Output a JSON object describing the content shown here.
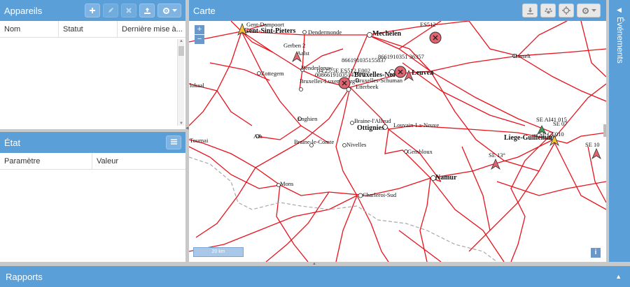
{
  "devices_panel": {
    "title": "Appareils",
    "columns": [
      "Nom",
      "Statut",
      "Dernière mise à..."
    ]
  },
  "state_panel": {
    "title": "État",
    "columns": [
      "Paramètre",
      "Valeur"
    ]
  },
  "map_panel": {
    "title": "Carte",
    "scale": "20 km",
    "zoom_in": "+",
    "zoom_out": "−",
    "info": "i",
    "cities": [
      {
        "name": "Gent-Dampoort"
      },
      {
        "name": "Gent-Sint-Pieters",
        "bold": true
      },
      {
        "name": "Dendermonde"
      },
      {
        "name": "Mechelen",
        "bold": true
      },
      {
        "name": "Gerben 2"
      },
      {
        "name": "Aalst"
      },
      {
        "name": "Denderleeuw"
      },
      {
        "name": "Zottegem"
      },
      {
        "name": "Bruxelles-Luxembourg"
      },
      {
        "name": "Bruxelles-Nord",
        "bold": true
      },
      {
        "name": "Leuven",
        "bold": true
      },
      {
        "name": "Bruxelles-Schuman"
      },
      {
        "name": "Etterbeek"
      },
      {
        "name": "Hasselt"
      },
      {
        "name": "Enghien"
      },
      {
        "name": "Ath"
      },
      {
        "name": "Braine-l'Alleud"
      },
      {
        "name": "Ottignies",
        "bold": true
      },
      {
        "name": "Louvain-La-Neuve"
      },
      {
        "name": "Braine-le-Comte"
      },
      {
        "name": "Nivelles"
      },
      {
        "name": "Gembloux"
      },
      {
        "name": "Namur",
        "bold": true
      },
      {
        "name": "Mons"
      },
      {
        "name": "Charleroi-Sud"
      },
      {
        "name": "Liege-Guillemins",
        "bold": true
      },
      {
        "name": "Tournai"
      },
      {
        "name": "lokaal"
      }
    ],
    "device_labels": [
      {
        "text": "ES512"
      },
      {
        "text": "866191035155837"
      },
      {
        "text": "8661910351 36357"
      },
      {
        "text": "04:25:5E ES512 E002"
      },
      {
        "text": "00866191035147777"
      },
      {
        "text": "SE 13°"
      },
      {
        "text": "SE AI41 015"
      },
      {
        "text": "SE 07"
      },
      {
        "text": "SE CE010"
      },
      {
        "text": "SE 10"
      }
    ],
    "colors": {
      "rail": "#e8121c",
      "marker": "#e06470"
    }
  },
  "events_panel": {
    "title": "Événements"
  },
  "reports_panel": {
    "title": "Rapports"
  },
  "icons": {
    "add": "plus-icon",
    "edit": "pencil-icon",
    "remove": "x-icon",
    "upload": "upload-icon",
    "settings": "gear-icon",
    "list": "list-icon",
    "download": "download-icon",
    "paw": "paw-icon",
    "crosshair": "crosshair-icon"
  }
}
